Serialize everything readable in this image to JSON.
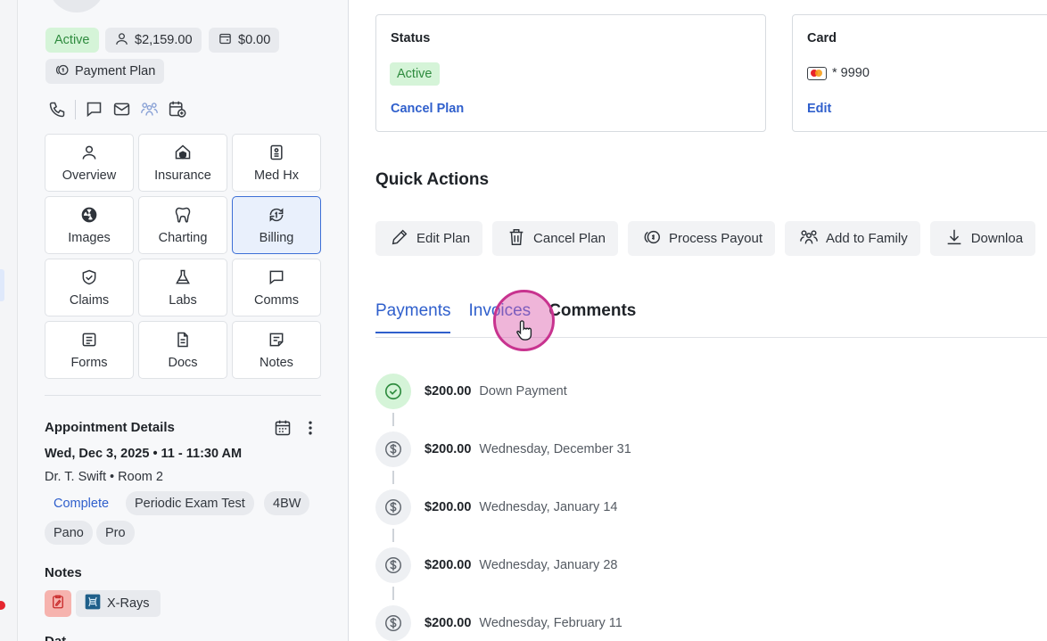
{
  "patient": {
    "status_chip": "Active",
    "balance_chip": "$2,159.00",
    "credit_chip": "$0.00",
    "plan_chip": "Payment Plan"
  },
  "contact_icons": [
    "phone-icon",
    "chat-icon",
    "mail-icon",
    "family-icon",
    "calendar-add-icon"
  ],
  "nav": {
    "overview": "Overview",
    "insurance": "Insurance",
    "medhx": "Med Hx",
    "images": "Images",
    "charting": "Charting",
    "billing": "Billing",
    "claims": "Claims",
    "labs": "Labs",
    "comms": "Comms",
    "forms": "Forms",
    "docs": "Docs",
    "notes": "Notes"
  },
  "appointment": {
    "title": "Appointment Details",
    "date": "Wed, Dec 3, 2025 • 11 - 11:30 AM",
    "provider": "Dr. T. Swift • Room 2",
    "status": "Complete",
    "tags": [
      "Periodic Exam Test",
      "4BW",
      "Pano",
      "Pro"
    ]
  },
  "notes": {
    "title": "Notes",
    "xray_label": "X-Rays"
  },
  "cut_off_heading": "Dat",
  "status_card": {
    "title": "Status",
    "badge": "Active",
    "link": "Cancel Plan"
  },
  "card_card": {
    "title": "Card",
    "number": "* 9990",
    "link": "Edit"
  },
  "quick_actions": {
    "title": "Quick Actions",
    "edit_plan": "Edit Plan",
    "cancel_plan": "Cancel Plan",
    "process_payout": "Process Payout",
    "add_family": "Add to Family",
    "download": "Downloa"
  },
  "tabs": {
    "payments": "Payments",
    "invoices": "Invoices",
    "comments": "Comments"
  },
  "payments": [
    {
      "amount": "$200.00",
      "label": "Down Payment",
      "status": "paid"
    },
    {
      "amount": "$200.00",
      "label": "Wednesday, December 31",
      "status": "scheduled"
    },
    {
      "amount": "$200.00",
      "label": "Wednesday, January 14",
      "status": "scheduled"
    },
    {
      "amount": "$200.00",
      "label": "Wednesday, January 28",
      "status": "scheduled"
    },
    {
      "amount": "$200.00",
      "label": "Wednesday, February 11",
      "status": "scheduled"
    }
  ],
  "colors": {
    "accent": "#2f5fcc",
    "success": "#2e8b3e",
    "success_bg": "#d5f4d8",
    "cursor_ring": "#c8338f"
  }
}
